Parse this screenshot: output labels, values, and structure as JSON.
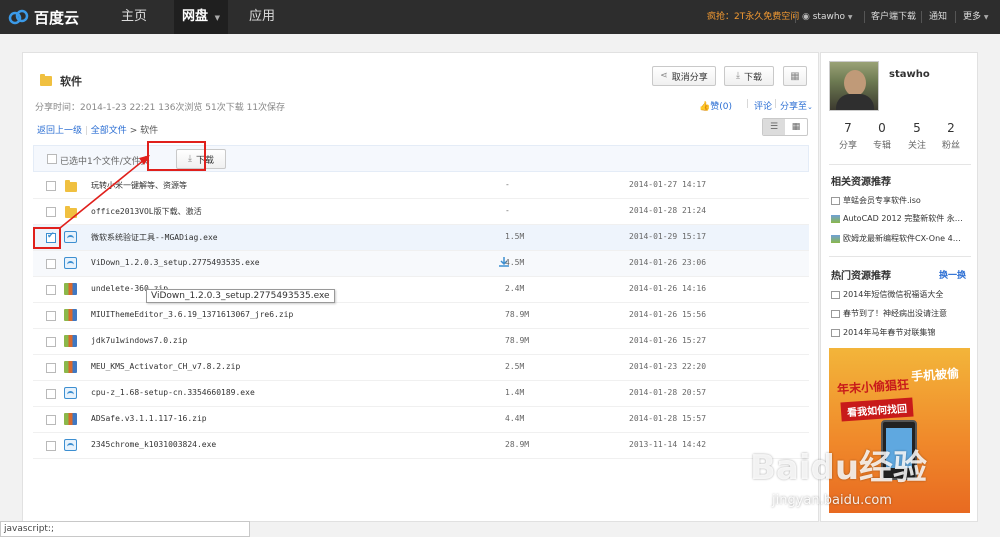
{
  "nav": {
    "logo": "百度云",
    "items": [
      "主页",
      "网盘",
      "应用"
    ],
    "promo": "疯抢：2T永久免费空间",
    "user": "stawho",
    "client": "客户端下载",
    "notify": "通知",
    "more": "更多"
  },
  "share": {
    "title": "软件",
    "cancel_share": "取消分享",
    "download": "下载",
    "meta": "分享时间：2014-1-23 22:21  136次浏览  51次下载  11次保存",
    "like": "赞(0)",
    "comment": "评论",
    "share_to": "分享至"
  },
  "breadcrumb": {
    "back": "返回上一级",
    "all": "全部文件",
    "current": "软件"
  },
  "toolbar": {
    "selected": "已选中1个文件/文件夹",
    "download": "下载"
  },
  "files": [
    {
      "name": "玩转小米一键解等、资源等",
      "size": "-",
      "date": "2014-01-27 14:17",
      "type": "folder"
    },
    {
      "name": "office2013VOL版下载、激活",
      "size": "-",
      "date": "2014-01-28 21:24",
      "type": "folder"
    },
    {
      "name": "微软系统验证工具--MGADiag.exe",
      "size": "1.5M",
      "date": "2014-01-29 15:17",
      "type": "exe"
    },
    {
      "name": "ViDown_1.2.0.3_setup.2775493535.exe",
      "size": "4.5M",
      "date": "2014-01-26 23:06",
      "type": "exe"
    },
    {
      "name": "undelete-360.zip",
      "size": "2.4M",
      "date": "2014-01-26 14:16",
      "type": "zip"
    },
    {
      "name": "MIUIThemeEditor_3.6.19_1371613067_jre6.zip",
      "size": "78.9M",
      "date": "2014-01-26 15:56",
      "type": "zip"
    },
    {
      "name": "jdk7u1windows7.0.zip",
      "size": "78.9M",
      "date": "2014-01-26 15:27",
      "type": "zip"
    },
    {
      "name": "MEU_KMS_Activator_CH_v7.8.2.zip",
      "size": "2.5M",
      "date": "2014-01-23 22:20",
      "type": "zip"
    },
    {
      "name": "cpu-z_1.68-setup-cn.3354660189.exe",
      "size": "1.4M",
      "date": "2014-01-28 20:57",
      "type": "exe"
    },
    {
      "name": "ADSafe.v3.1.1.117-16.zip",
      "size": "4.4M",
      "date": "2014-01-28 15:57",
      "type": "zip"
    },
    {
      "name": "2345chrome_k1031003824.exe",
      "size": "28.9M",
      "date": "2013-11-14 14:42",
      "type": "exe"
    }
  ],
  "tooltip": "ViDown_1.2.0.3_setup.2775493535.exe",
  "statusbar": "javascript:;",
  "profile": {
    "name": "stawho",
    "stats": [
      {
        "n": "7",
        "l": "分享"
      },
      {
        "n": "0",
        "l": "专辑"
      },
      {
        "n": "5",
        "l": "关注"
      },
      {
        "n": "2",
        "l": "粉丝"
      }
    ]
  },
  "related": {
    "title": "相关资源推荐",
    "items": [
      "草蜢会员专享软件.iso",
      "AutoCAD 2012 完整新软件 永…",
      "欧姆龙最新编程软件CX-One 4…"
    ]
  },
  "hot": {
    "title": "热门资源推荐",
    "swap": "换一换",
    "items": [
      "2014年短信微信祝福语大全",
      "春节到了！神经病出没请注意",
      "2014年马年春节对联集锦"
    ]
  },
  "ad": {
    "line1": "年末小偷猖狂",
    "line2": "手机被偷",
    "line3": "看我如何找回"
  },
  "watermark": {
    "text": "Baidu经验",
    "url": "jingyan.baidu.com"
  }
}
